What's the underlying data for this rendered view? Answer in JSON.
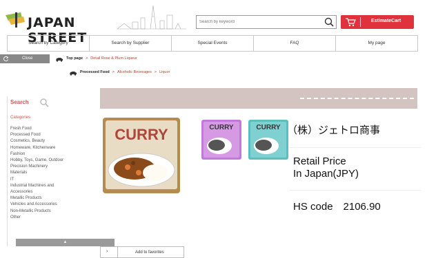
{
  "header": {
    "brand": "JAPAN STREET",
    "search_placeholder": "Search by keyword",
    "cart_label": "EstimateCart"
  },
  "nav": {
    "items": [
      "Search by Category",
      "Search by Supplier",
      "Special Events",
      "FAQ",
      "My page"
    ]
  },
  "breadcrumb": {
    "close_label": "Close",
    "row1": [
      "Top page",
      "Detail Rose & Plum Liqueur"
    ],
    "row2": [
      "Processed Food",
      "Alcoholic Beverages",
      "Liquor"
    ]
  },
  "sidebar": {
    "search_title": "Search",
    "categories_title": "Categories",
    "categories": [
      "Fresh Food",
      "Processed Food",
      "Cosmetics, Beauty",
      "Homeware, Kitchenware",
      "Fashion",
      "Hobby, Toys, Game, Outdoor",
      "Precision Machinery",
      "Materials",
      "IT",
      "Industrial Machines and\nAccessories",
      "Metallic Products",
      "Vehicles and Accessories",
      "Non-Metallic Products",
      "Other"
    ],
    "collapse_symbol": "▲"
  },
  "product": {
    "main_image_text": "CURRY",
    "thumb_text": "CURRY",
    "company": "（株）ジェトロ商事",
    "retail_line1": "Retail Price",
    "retail_line2": "In Japan(JPY)",
    "hs_code": "HS code　2106.90"
  },
  "favorites": {
    "arrow": "›",
    "label": "Add to favorites"
  },
  "colors": {
    "accent_red": "#e0323c",
    "banner": "#d3c4c1",
    "curry_purple": "#c07ad8",
    "curry_teal": "#5bbfc0"
  }
}
